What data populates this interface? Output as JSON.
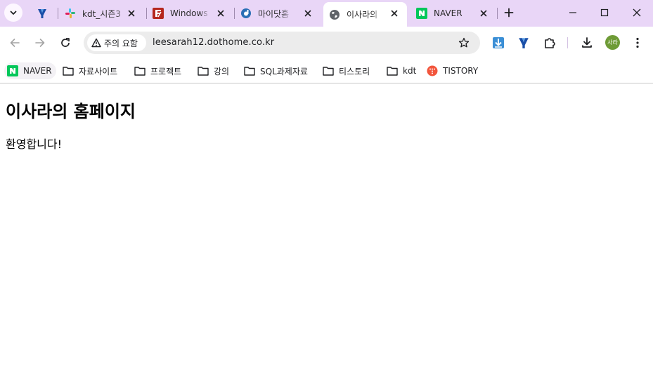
{
  "tabs": [
    {
      "title": "",
      "favicon": "ypass-icon"
    },
    {
      "title": "kdt_시즌3",
      "favicon": "slack-icon"
    },
    {
      "title": "Windows",
      "favicon": "filezilla-icon"
    },
    {
      "title": "마이닷홈",
      "favicon": "dothome-icon"
    },
    {
      "title": "이사라의",
      "favicon": "globe-icon",
      "active": true
    },
    {
      "title": "NAVER",
      "favicon": "naver-icon"
    }
  ],
  "omnibox": {
    "security_chip": "주의 요함",
    "url": "leesarah12.dothome.co.kr"
  },
  "profile": {
    "avatar_text": "사라"
  },
  "bookmarks": [
    {
      "label": "NAVER",
      "icon": "naver-icon"
    },
    {
      "label": "자료사이트",
      "icon": "folder-icon"
    },
    {
      "label": "프로젝트",
      "icon": "folder-icon"
    },
    {
      "label": "강의",
      "icon": "folder-icon"
    },
    {
      "label": "SQL과제자료",
      "icon": "folder-icon"
    },
    {
      "label": "티스토리",
      "icon": "folder-icon"
    },
    {
      "label": "kdt",
      "icon": "folder-icon"
    },
    {
      "label": "TISTORY",
      "icon": "tistory-icon"
    }
  ],
  "page": {
    "heading": "이사라의 홈페이지",
    "paragraph": "환영합니다!"
  },
  "colors": {
    "tabstrip": "#e9d6f7",
    "naver_green": "#03c75a",
    "tistory_red": "#f2553c",
    "avatar": "#6e9b36",
    "download_blue": "#3b8fd6"
  }
}
